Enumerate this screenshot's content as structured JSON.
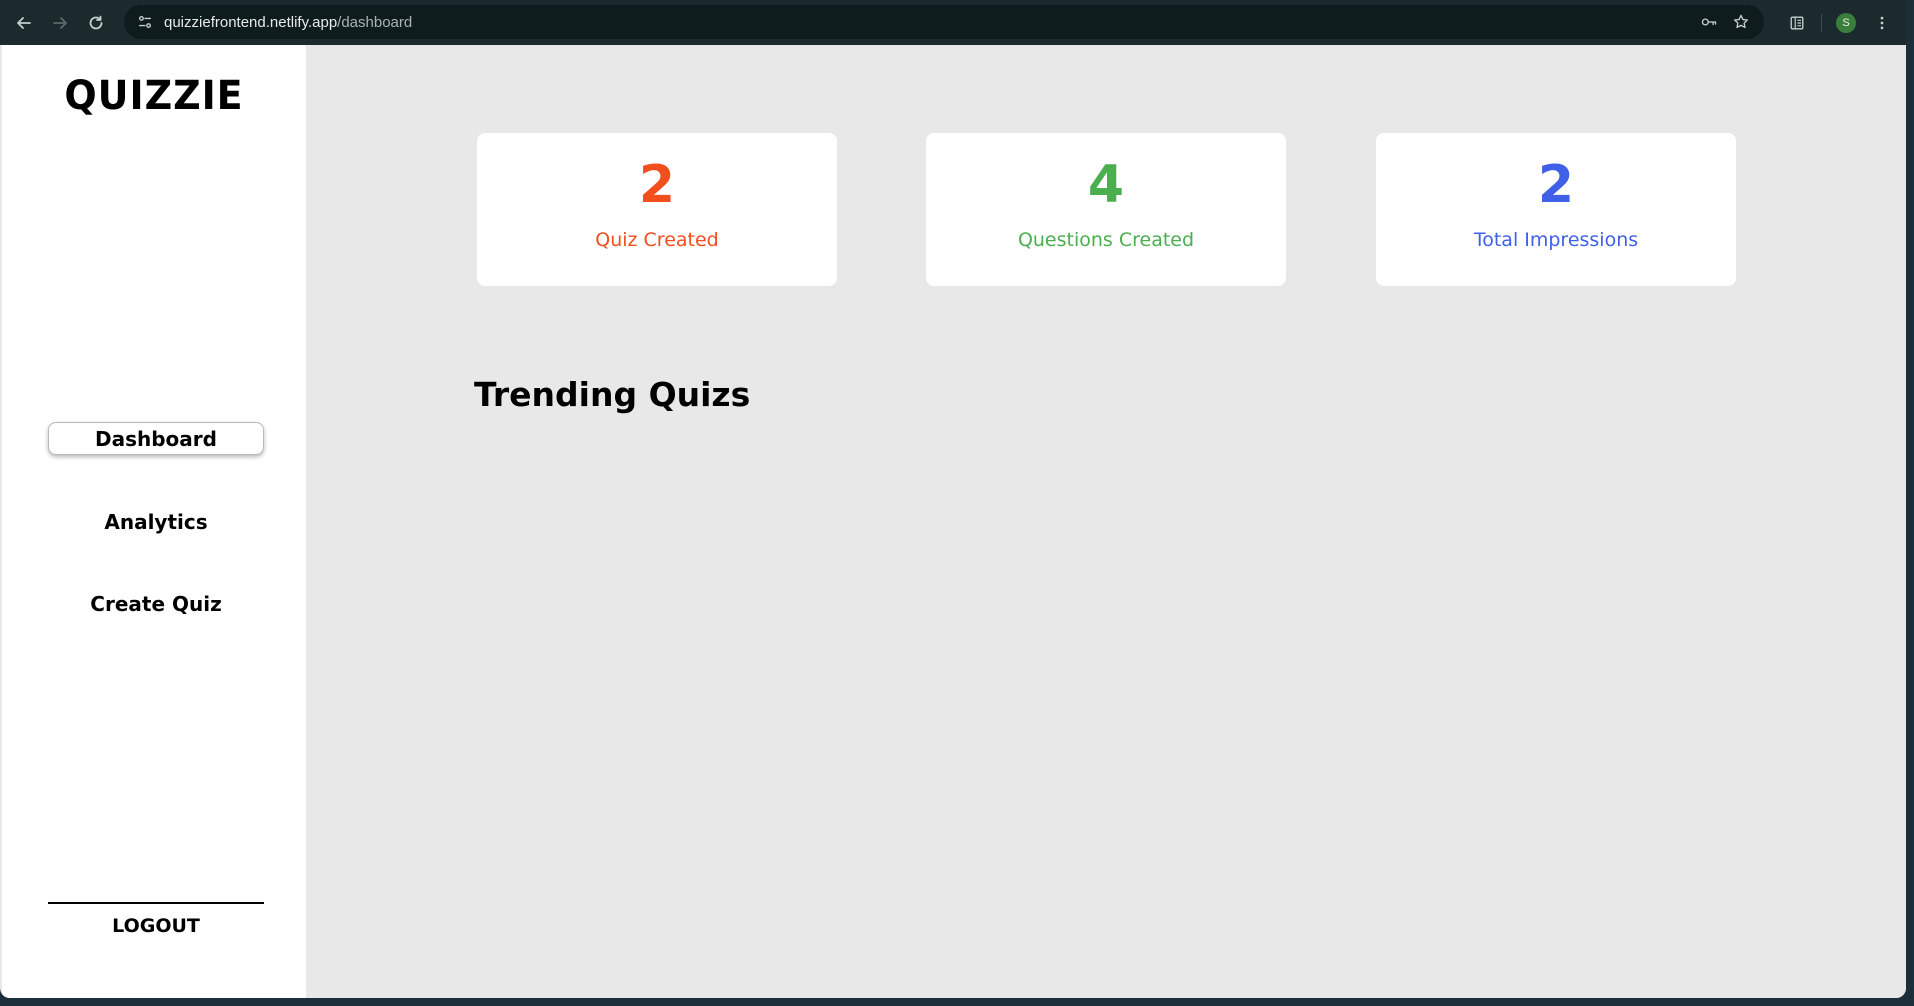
{
  "browser": {
    "url_host": "quizziefrontend.netlify.app",
    "url_path": "/dashboard",
    "profile_initial": "S"
  },
  "sidebar": {
    "logo": "QUIZZIE",
    "items": [
      {
        "label": "Dashboard",
        "active": true
      },
      {
        "label": "Analytics",
        "active": false
      },
      {
        "label": "Create Quiz",
        "active": false
      }
    ],
    "logout_label": "LOGOUT"
  },
  "stats": [
    {
      "value": "2",
      "label": "Quiz Created",
      "color": "#f24e1e"
    },
    {
      "value": "4",
      "label": "Questions Created",
      "color": "#4bae4f"
    },
    {
      "value": "2",
      "label": "Total Impressions",
      "color": "#4060e8"
    }
  ],
  "main": {
    "section_title": "Trending Quizs"
  }
}
